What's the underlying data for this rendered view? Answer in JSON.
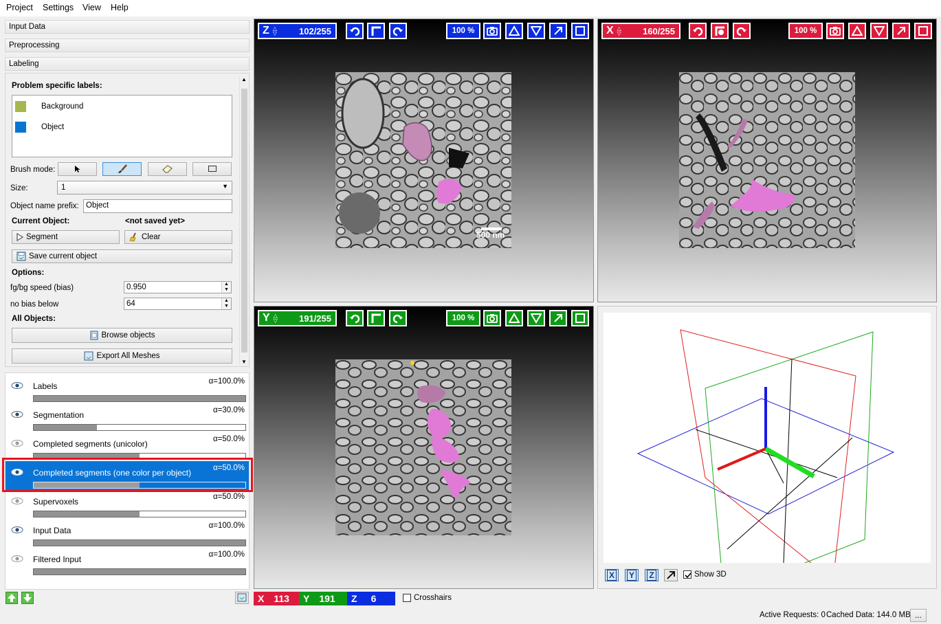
{
  "menu": [
    "Project",
    "Settings",
    "View",
    "Help"
  ],
  "applets": {
    "input_data": "Input Data",
    "preprocessing": "Preprocessing",
    "labeling": "Labeling"
  },
  "labeling": {
    "labels_heading": "Problem specific labels:",
    "labels": [
      {
        "name": "Background",
        "color": "#a5b74e"
      },
      {
        "name": "Object",
        "color": "#0a75d0"
      }
    ],
    "brush_mode_label": "Brush mode:",
    "size_label": "Size:",
    "size_value": "1",
    "prefix_label": "Object name prefix:",
    "prefix_value": "Object",
    "current_object_label": "Current Object:",
    "current_object_value": "<not saved yet>",
    "segment_button": "Segment",
    "clear_button": "Clear",
    "save_button": "Save current object",
    "options_label": "Options:",
    "bias_label": "fg/bg speed (bias)",
    "bias_value": "0.950",
    "nobias_label": "no bias below",
    "nobias_value": "64",
    "all_objects_label": "All Objects:",
    "browse_button": "Browse objects",
    "export_button": "Export All Meshes"
  },
  "layers": [
    {
      "name": "Labels",
      "alpha": "α=100.0%",
      "fill": 1.0,
      "visible": true,
      "selected": false
    },
    {
      "name": "Segmentation",
      "alpha": "α=30.0%",
      "fill": 0.3,
      "visible": true,
      "selected": false
    },
    {
      "name": "Completed segments (unicolor)",
      "alpha": "α=50.0%",
      "fill": 0.5,
      "visible": false,
      "selected": false
    },
    {
      "name": "Completed segments (one color per object)",
      "alpha": "α=50.0%",
      "fill": 0.5,
      "visible": true,
      "selected": true
    },
    {
      "name": "Supervoxels",
      "alpha": "α=50.0%",
      "fill": 0.5,
      "visible": false,
      "selected": false
    },
    {
      "name": "Input Data",
      "alpha": "α=100.0%",
      "fill": 1.0,
      "visible": true,
      "selected": false
    },
    {
      "name": "Filtered Input",
      "alpha": "α=100.0%",
      "fill": 1.0,
      "visible": false,
      "selected": false
    }
  ],
  "views": {
    "z": {
      "axis": "Z",
      "slice": "102/255",
      "zoom": "100 %",
      "color": "#0a2de0"
    },
    "x": {
      "axis": "X",
      "slice": "160/255",
      "zoom": "100 %",
      "color": "#dd1b3d"
    },
    "y": {
      "axis": "Y",
      "slice": "191/255",
      "zoom": "100 %",
      "color": "#0e9a16"
    },
    "scalebar": "500 nm"
  },
  "view3d": {
    "show3d_label": "Show 3D",
    "show3d_checked": true,
    "axis_buttons": [
      "X",
      "Y",
      "Z"
    ]
  },
  "coords": {
    "x_label": "X",
    "x_value": "113",
    "y_label": "Y",
    "y_value": "191",
    "z_label": "Z",
    "z_value": "6",
    "crosshairs_label": "Crosshairs"
  },
  "status": {
    "active_requests": "Active Requests: 0",
    "cached_data": "Cached Data: 144.0 MB",
    "more_button": "..."
  },
  "icons": [
    "eye-icon",
    "undo-icon",
    "redo-icon",
    "camera-icon",
    "triangle-up-icon",
    "triangle-down-icon",
    "maximize-icon",
    "square-icon",
    "pointer-icon",
    "brush-icon",
    "eraser-icon",
    "rectangle-icon",
    "broom-icon",
    "play-icon",
    "save-icon",
    "arrow-up-icon",
    "arrow-down-icon"
  ]
}
